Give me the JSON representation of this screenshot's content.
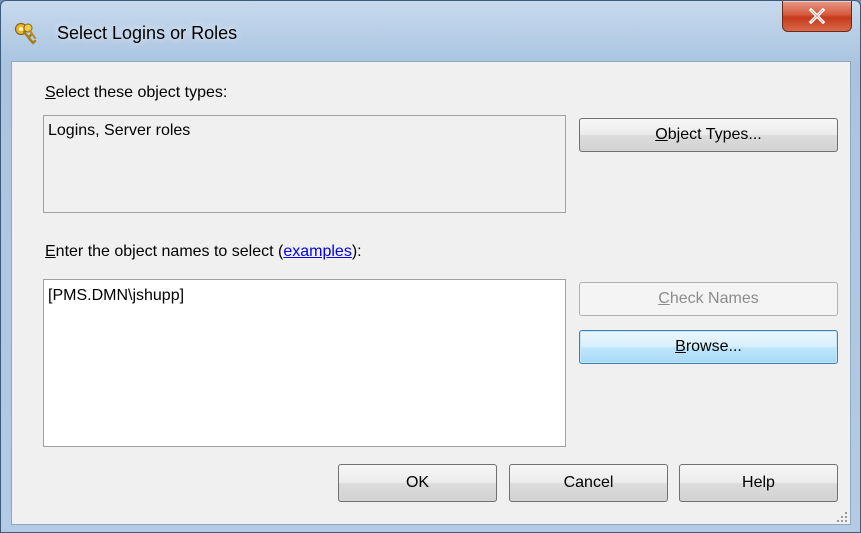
{
  "window": {
    "title": "Select Logins or Roles",
    "close_glyph": "X"
  },
  "object_types": {
    "label_accel": "S",
    "label_rest": "elect these object types:",
    "value": "Logins, Server roles",
    "button_accel": "O",
    "button_rest": "bject Types..."
  },
  "names": {
    "label_accel": "E",
    "label_rest": "nter the object names to select (",
    "link": "examples",
    "label_end": "):",
    "value": "[PMS.DMN\\jshupp]"
  },
  "buttons": {
    "check_names_accel": "C",
    "check_names_rest": "heck Names",
    "browse_accel": "B",
    "browse_rest": "rowse...",
    "ok": "OK",
    "cancel": "Cancel",
    "help": "Help"
  },
  "colors": {
    "link": "#0000ee",
    "close_button": "#c7391c",
    "default_button_border": "#3c7fb1"
  },
  "icons": {
    "title": "keys-icon",
    "close": "close-icon",
    "grip": "resize-grip-icon"
  }
}
